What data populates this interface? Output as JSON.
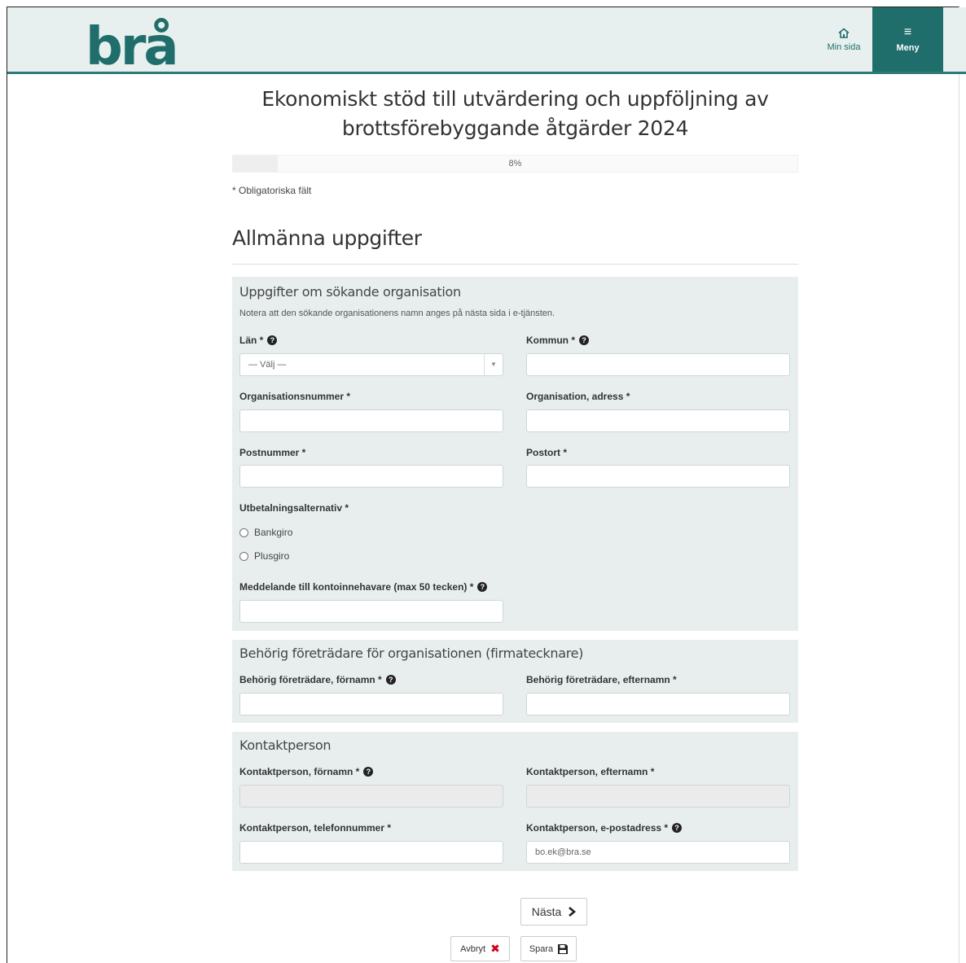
{
  "header": {
    "logo_text": "brå",
    "home_label": "Min sida",
    "menu_label": "Meny"
  },
  "form": {
    "title_line1": "Ekonomiskt stöd till utvärdering och uppföljning av",
    "title_line2": "brottsförebyggande åtgärder 2024",
    "progress_percent": 8,
    "progress_label": "8%",
    "required_note": "* Obligatoriska fält",
    "section_title": "Allmänna uppgifter"
  },
  "org_panel": {
    "title": "Uppgifter om sökande organisation",
    "note": "Notera att den sökande organisationens namn anges på nästa sida i e-tjänsten.",
    "lan_label": "Län *",
    "lan_selected": "— Välj —",
    "kommun_label": "Kommun *",
    "orgnr_label": "Organisationsnummer *",
    "org_address_label": "Organisation, adress *",
    "postnummer_label": "Postnummer *",
    "postort_label": "Postort *",
    "payment_label": "Utbetalningsalternativ *",
    "payment_options": [
      "Bankgiro",
      "Plusgiro"
    ],
    "message_label": "Meddelande till kontoinnehavare (max 50 tecken) *"
  },
  "rep_panel": {
    "title": "Behörig företrädare för organisationen (firmatecknare)",
    "firstname_label": "Behörig företrädare, förnamn *",
    "lastname_label": "Behörig företrädare, efternamn *"
  },
  "contact_panel": {
    "title": "Kontaktperson",
    "firstname_label": "Kontaktperson, förnamn *",
    "lastname_label": "Kontaktperson, efternamn *",
    "phone_label": "Kontaktperson, telefonnummer *",
    "email_label": "Kontaktperson, e-postadress *",
    "email_value": "bo.ek@bra.se"
  },
  "buttons": {
    "next": "Nästa",
    "cancel": "Avbryt",
    "save": "Spara"
  },
  "colors": {
    "brand_teal": "#1f6e6c",
    "header_bg": "#e8f0ef",
    "panel_bg": "#e8eeee",
    "cancel_icon": "#d0021b"
  }
}
